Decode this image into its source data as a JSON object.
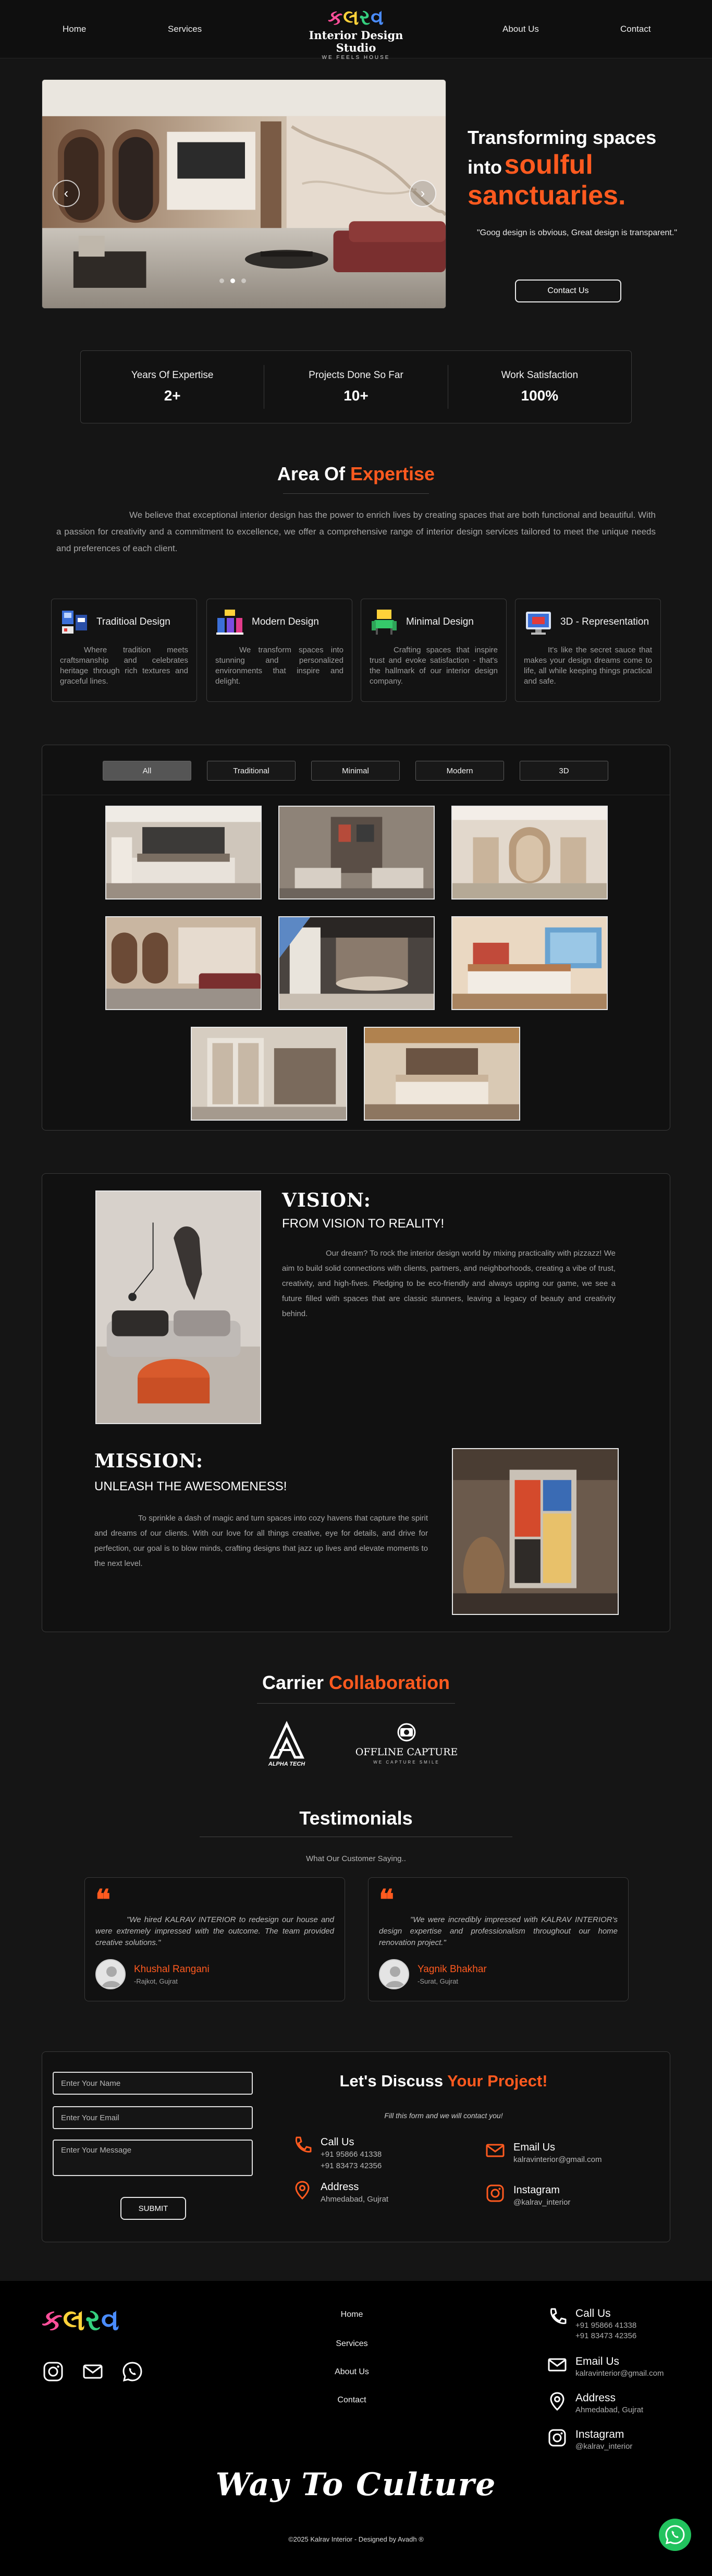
{
  "nav": {
    "home": "Home",
    "services": "Services",
    "about": "About Us",
    "contact": "Contact",
    "logo_glyphs": [
      "ક",
      "લ",
      "ર",
      "વ"
    ],
    "logo_title": "Interior Design Studio",
    "logo_tagline": "WE FEELS HOUSE"
  },
  "hero": {
    "title_line1": "Transforming spaces",
    "title_into": "into",
    "title_soulful": "soulful",
    "title_line3": "sanctuaries.",
    "quote": "\"Goog design is obvious, Great design is transparent.\"",
    "contact_button": "Contact Us",
    "slide_count": 3,
    "active_slide": 1,
    "prev_icon": "chevron-left-icon",
    "next_icon": "chevron-right-icon"
  },
  "stats": [
    {
      "label": "Years Of Expertise",
      "value": "2+"
    },
    {
      "label": "Projects Done So Far",
      "value": "10+"
    },
    {
      "label": "Work Satisfaction",
      "value": "100%"
    }
  ],
  "expertise": {
    "title_white": "Area Of",
    "title_orange": "Expertise",
    "description": "We believe that exceptional interior design has the power to enrich lives by creating spaces that are both functional and beautiful. With a passion for creativity and a commitment to excellence, we offer a comprehensive range of interior design services tailored to meet the unique needs and preferences of each client.",
    "cards": [
      {
        "title": "Traditioal Design",
        "icon": "traditional-design-icon",
        "text": "Where tradition meets craftsmanship and celebrates heritage through rich textures and graceful lines."
      },
      {
        "title": "Modern Design",
        "icon": "modern-design-icon",
        "text": "We transform spaces into stunning and personalized environments that inspire and delight."
      },
      {
        "title": "Minimal Design",
        "icon": "minimal-design-icon",
        "text": "Crafting spaces that inspire trust and evoke satisfaction - that's the hallmark of our interior design company."
      },
      {
        "title": "3D - Representation",
        "icon": "3d-representation-icon",
        "text": "It's like the secret sauce that makes your design dreams come to life, all while keeping things practical and safe."
      }
    ]
  },
  "gallery": {
    "filters": [
      "All",
      "Traditional",
      "Minimal",
      "Modern",
      "3D"
    ],
    "active_filter": "All"
  },
  "vision": {
    "heading": "VISION:",
    "subheading": "FROM VISION TO REALITY!",
    "text": "Our dream? To rock the interior design world by mixing practicality with pizzazz! We aim to build solid connections with clients, partners, and neighborhoods, creating a vibe of trust, creativity, and high-fives. Pledging to be eco-friendly and always upping our game, we see a future filled with spaces that are classic stunners, leaving a legacy of beauty and creativity behind."
  },
  "mission": {
    "heading": "MISSION:",
    "subheading": "UNLEASH THE AWESOMENESS!",
    "text": "To sprinkle a dash of magic and turn spaces into cozy havens that capture the spirit and dreams of our clients. With our love for all things creative, eye for details, and drive for perfection, our goal is to blow minds, crafting designs that jazz up lives and elevate moments to the next level."
  },
  "carrier": {
    "title_white": "Carrier",
    "title_orange": "Collaboration",
    "logos": [
      {
        "name": "ALPHA TECH"
      },
      {
        "name": "OFFLINE CAPTURE",
        "tagline": "WE CAPTURE SMILE"
      }
    ]
  },
  "testimonials": {
    "title": "Testimonials",
    "subtitle": "What Our Customer Saying..",
    "items": [
      {
        "text": "\"We hired KALRAV INTERIOR to redesign our house and were extremely impressed with the outcome. The team provided creative solutions.\"",
        "name": "Khushal Rangani",
        "location": "-Rajkot, Gujrat"
      },
      {
        "text": "\"We were incredibly impressed with KALRAV INTERIOR's design expertise and professionalism throughout our home renovation project.\"",
        "name": "Yagnik Bhakhar",
        "location": "-Surat, Gujrat"
      }
    ]
  },
  "contact_form": {
    "name_placeholder": "Enter Your Name",
    "email_placeholder": "Enter Your Email",
    "message_placeholder": "Enter Your Message",
    "submit_label": "SUBMIT",
    "title_white": "Let's Discuss",
    "title_orange": "Your Project!",
    "subtitle": "Fill this form and we will contact you!",
    "call_title": "Call Us",
    "phone1": "+91 95866 41338",
    "phone2": "+91 83473 42356",
    "email_title": "Email Us",
    "email": "kalravinterior@gmail.com",
    "address_title": "Address",
    "address": "Ahmedabad, Gujrat",
    "instagram_title": "Instagram",
    "instagram": "@kalrav_interior",
    "accent_color": "#ff5a1f"
  },
  "footer": {
    "links": [
      "Home",
      "Services",
      "About Us",
      "Contact"
    ],
    "socials": [
      "instagram-icon",
      "email-icon",
      "whatsapp-icon"
    ],
    "call_title": "Call Us",
    "phone1": "+91 95866 41338",
    "phone2": "+91 83473 42356",
    "email_title": "Email Us",
    "email": "kalravinterior@gmail.com",
    "address_title": "Address",
    "address": "Ahmedabad, Gujrat",
    "instagram_title": "Instagram",
    "instagram": "@kalrav_interior",
    "slogan": "Way To Culture",
    "copyright": "©2025 Kalrav Interior - Designed by Avadh ®"
  }
}
